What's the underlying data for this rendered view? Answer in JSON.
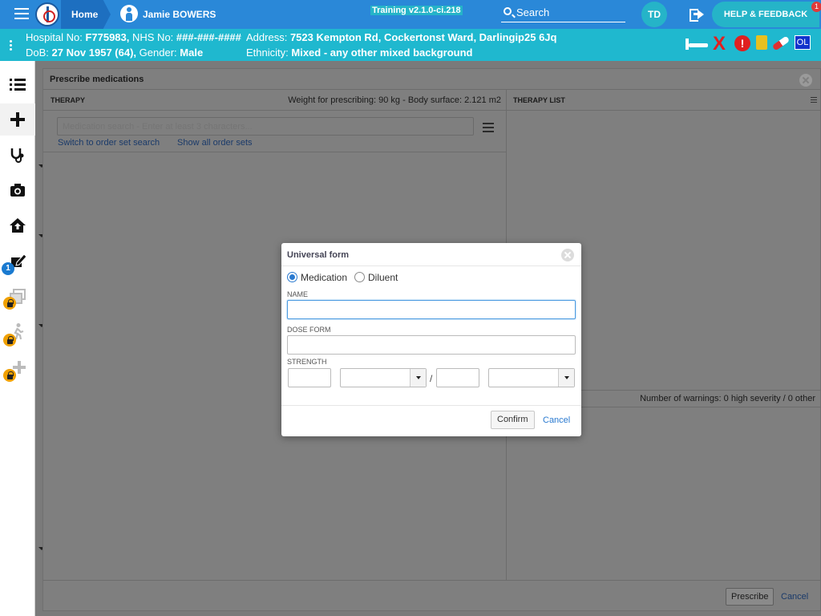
{
  "topbar": {
    "home_label": "Home",
    "patient_name": "Jamie BOWERS",
    "training_label": "Training v2.1.0-ci.218",
    "search_label": "Search",
    "user_initials": "TD",
    "help_label": "HELP & FEEDBACK",
    "help_badge": "1"
  },
  "banner": {
    "hospital_no_label": "Hospital No:",
    "hospital_no": "F775983,",
    "nhs_no_label": "NHS No:",
    "nhs_no": "###-###-####",
    "address_label": "Address:",
    "address": "7523 Kempton Rd, Cockertonst Ward, Darlingip25 6Jq",
    "dob_label": "DoB:",
    "dob": "27 Nov 1957 (64),",
    "gender_label": "Gender:",
    "gender": "Male",
    "ethnicity_label": "Ethnicity:",
    "ethnicity": "Mixed - any other mixed background",
    "alert_symbol": "!",
    "x_symbol": "X",
    "ol_label": "OL"
  },
  "sidebar": {
    "items": [
      {
        "icon": "list-icon"
      },
      {
        "icon": "plus-icon"
      },
      {
        "icon": "stethoscope-icon"
      },
      {
        "icon": "camera-icon"
      },
      {
        "icon": "house-icon"
      },
      {
        "icon": "prescription-edit-icon",
        "badge": "1"
      },
      {
        "icon": "documents-icon",
        "locked": true
      },
      {
        "icon": "walking-person-icon",
        "locked": true
      },
      {
        "icon": "add-item-icon",
        "locked": true
      }
    ]
  },
  "prescribe": {
    "title": "Prescribe medications",
    "therapy_label": "THERAPY",
    "weight_text": "Weight for prescribing: 90 kg - Body surface: 2.121 m2",
    "therapy_list_label": "THERAPY LIST",
    "search_placeholder": "Medication search - Enter at least 3 characters...",
    "switch_link": "Switch to order set search",
    "show_all_link": "Show all order sets",
    "warnings_text": "Number of warnings: 0 high severity / 0 other",
    "prescribe_button": "Prescribe",
    "cancel_link": "Cancel"
  },
  "modal": {
    "title": "Universal form",
    "radio_medication": "Medication",
    "radio_diluent": "Diluent",
    "selected_type": "Medication",
    "name_label": "NAME",
    "name_value": "",
    "dose_form_label": "DOSE FORM",
    "dose_form_value": "",
    "strength_label": "STRENGTH",
    "strength_separator": "/",
    "confirm_button": "Confirm",
    "cancel_link": "Cancel"
  },
  "colors": {
    "topbar": "#2a88d8",
    "banner": "#1fb8cf",
    "accent_teal": "#25b4c8",
    "alert_red": "#e02020",
    "lock_orange": "#f0a000",
    "link_blue": "#2a7ad0"
  }
}
